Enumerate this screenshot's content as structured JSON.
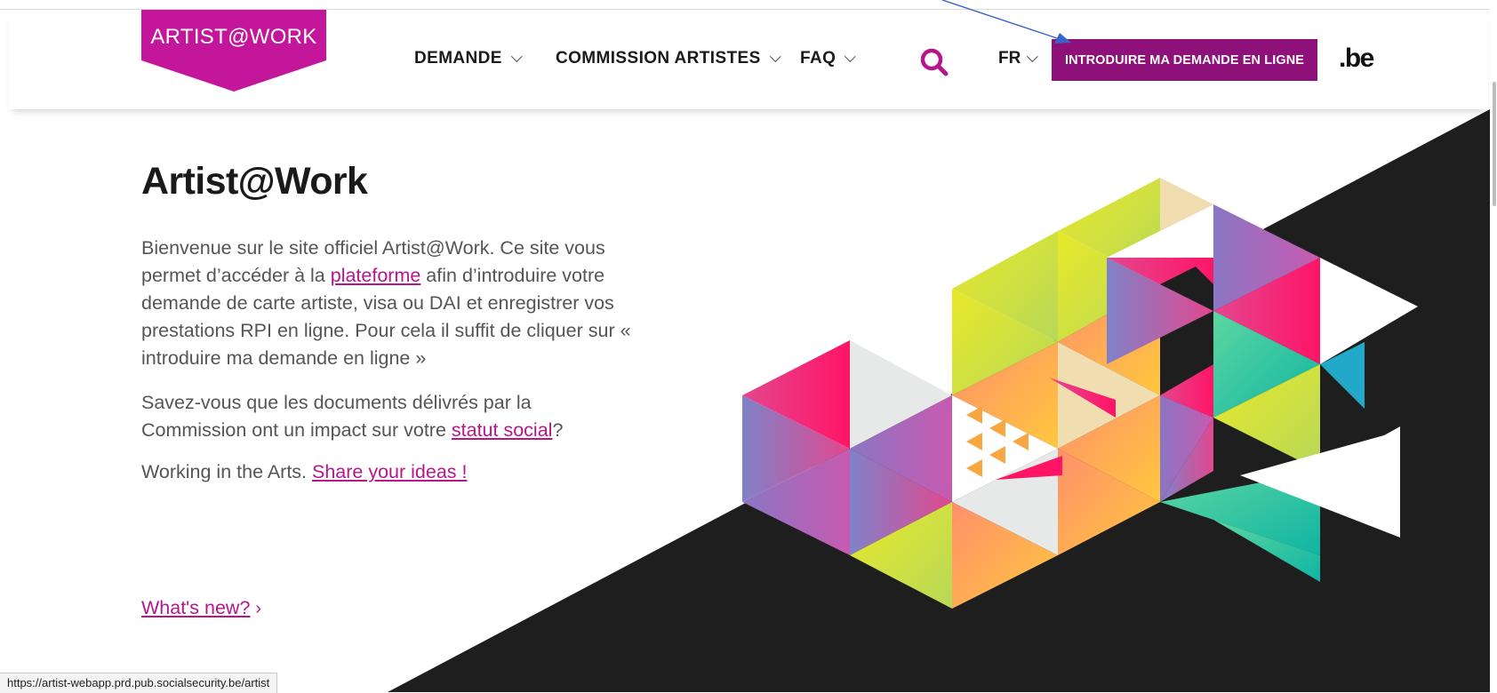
{
  "header": {
    "logo_text": "ARTIST@WORK",
    "nav": [
      {
        "label": "DEMANDE"
      },
      {
        "label": "COMMISSION ARTISTES"
      },
      {
        "label": "FAQ"
      }
    ],
    "language": "FR",
    "cta_label": "INTRODUIRE MA DEMANDE EN LIGNE",
    "be_logo": ".be"
  },
  "main": {
    "title": "Artist@Work",
    "intro_before": "Bienvenue sur le site officiel Artist@Work. Ce site vous permet d’accéder à la ",
    "intro_link": "plateforme",
    "intro_after": " afin d’introduire votre demande de carte artiste, visa ou DAI et enregistrer vos prestations RPI en ligne. Pour cela il suffit de cliquer sur « introduire ma demande en ligne »",
    "social_before": "Savez-vous que les documents délivrés par la Commission ont un impact sur votre ",
    "social_link": "statut social",
    "social_after": "?",
    "arts_text": "Working in the Arts. ",
    "arts_link": "Share your ideas !",
    "whats_new": "What's new?"
  },
  "status_bar": {
    "url": "https://artist-webapp.prd.pub.socialsecurity.be/artist"
  },
  "colors": {
    "brand_magenta": "#c4169a",
    "cta_purple": "#8e1079",
    "link": "#b5168c",
    "dark_band": "#1e1e1e"
  },
  "icons": [
    "search-icon",
    "chevron-down-icon",
    "annotation-arrow"
  ]
}
